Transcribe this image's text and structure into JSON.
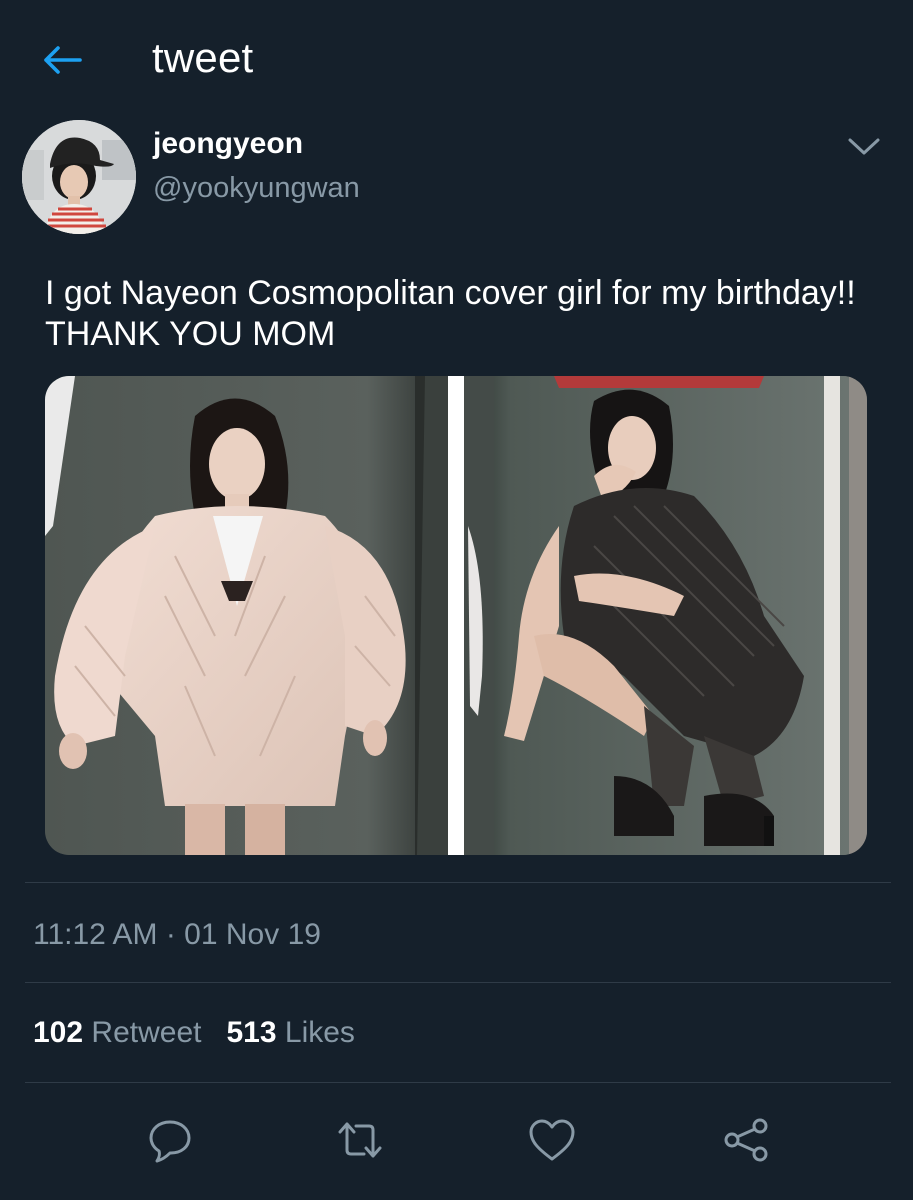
{
  "header": {
    "back_icon": "arrow-left-icon",
    "title": "tweet"
  },
  "tweet": {
    "display_name": "jeongyeon",
    "handle": "@yookyungwan",
    "text": "I got Nayeon Cosmopolitan cover girl for my birthday!! THANK YOU MOM",
    "timestamp": "11:12 AM · 01 Nov 19",
    "retweet_count": "102",
    "retweet_label": "Retweet",
    "like_count": "513",
    "like_label": "Likes"
  },
  "colors": {
    "background": "#15202b",
    "accent": "#1da1f2",
    "secondary_text": "#8899a6",
    "divider": "#2f3b47"
  },
  "actions": [
    {
      "icon": "reply-icon"
    },
    {
      "icon": "retweet-icon"
    },
    {
      "icon": "like-heart-icon"
    },
    {
      "icon": "share-icon"
    }
  ]
}
